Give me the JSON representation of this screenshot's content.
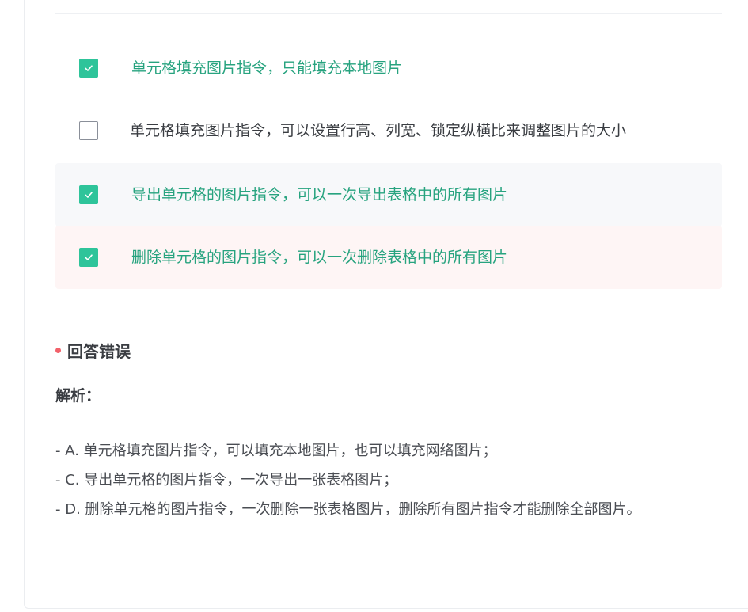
{
  "options": [
    {
      "text": "单元格填充图片指令，只能填充本地图片",
      "checked": true
    },
    {
      "text": "单元格填充图片指令，可以设置行高、列宽、锁定纵横比来调整图片的大小",
      "checked": false
    },
    {
      "text": "导出单元格的图片指令，可以一次导出表格中的所有图片",
      "checked": true
    },
    {
      "text": "删除单元格的图片指令，可以一次删除表格中的所有图片",
      "checked": true
    }
  ],
  "result": {
    "label": "回答错误",
    "status_color": "#f2616a"
  },
  "analysis": {
    "title": "解析：",
    "lines": [
      "- A. 单元格填充图片指令，可以填充本地图片，也可以填充网络图片；",
      "- C. 导出单元格的图片指令，一次导出一张表格图片；",
      "- D. 删除单元格的图片指令，一次删除一张表格图片，删除所有图片指令才能删除全部图片。"
    ]
  },
  "colors": {
    "accent": "#2ec49a",
    "selected_text": "#27a37f",
    "wrong_bg": "#fef5f5",
    "highlight_bg": "#f7f8fa"
  },
  "icons": {
    "checked": "check-icon"
  }
}
